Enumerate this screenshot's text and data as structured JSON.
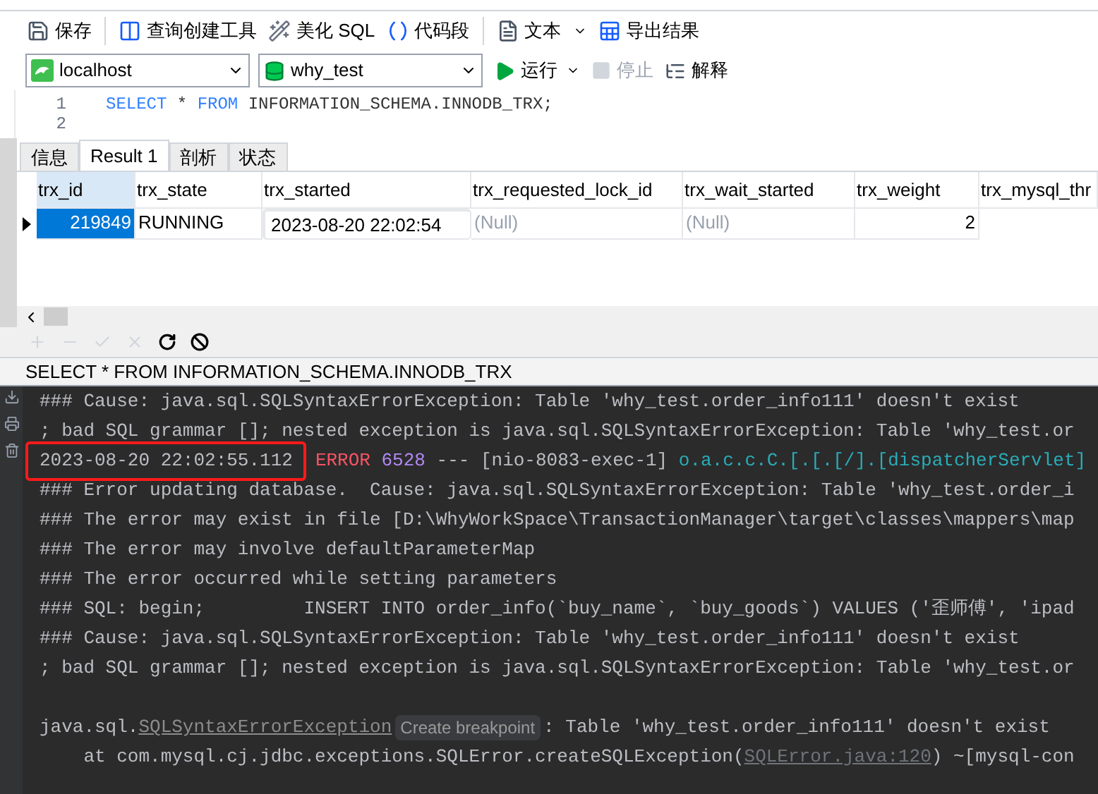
{
  "toolbar": [
    {
      "label": "保存",
      "kind": "save"
    },
    {
      "label": "查询创建工具",
      "kind": "builder"
    },
    {
      "label": "美化 SQL",
      "kind": "beautify"
    },
    {
      "label": "代码段",
      "kind": "snippet"
    },
    {
      "label": "文本",
      "kind": "text",
      "dropdown": true
    },
    {
      "label": "导出结果",
      "kind": "export"
    }
  ],
  "connection": {
    "server": "localhost",
    "database": "why_test"
  },
  "actions": [
    {
      "label": "运行",
      "kind": "run",
      "dropdown": true,
      "disabled": false
    },
    {
      "label": "停止",
      "kind": "stop",
      "disabled": true
    },
    {
      "label": "解释",
      "kind": "explain",
      "disabled": false
    }
  ],
  "editor": {
    "lines": [
      {
        "number": "1",
        "tokens": [
          {
            "text": "SELECT",
            "kind": "keyword"
          },
          {
            "text": " * ",
            "kind": "plain"
          },
          {
            "text": "FROM",
            "kind": "keyword"
          },
          {
            "text": " INFORMATION_SCHEMA.INNODB_TRX;",
            "kind": "plain"
          }
        ]
      },
      {
        "number": "2"
      }
    ]
  },
  "tabs": [
    {
      "label": "信息",
      "selected": false
    },
    {
      "label": "Result 1",
      "selected": true
    },
    {
      "label": "剖析",
      "selected": false
    },
    {
      "label": "状态",
      "selected": false
    }
  ],
  "table": {
    "columns": [
      "trx_id",
      "trx_state",
      "trx_started",
      "trx_requested_lock_id",
      "trx_wait_started",
      "trx_weight",
      "trx_mysql_thr"
    ],
    "rows": [
      {
        "selected": true,
        "cells": [
          {
            "text": "219849",
            "kind": "number",
            "highlighted": false
          },
          {
            "text": "RUNNING",
            "kind": "text",
            "highlighted": false
          },
          {
            "text": "2023-08-20 22:02:54",
            "kind": "text",
            "highlighted": true
          },
          {
            "text": "(Null)",
            "kind": "null",
            "highlighted": false
          },
          {
            "text": "(Null)",
            "kind": "null",
            "highlighted": false
          },
          {
            "text": "2",
            "kind": "number",
            "highlighted": false
          }
        ]
      }
    ]
  },
  "grid_toolbar": [
    {
      "kind": "add",
      "disabled": true
    },
    {
      "kind": "delete",
      "disabled": true
    },
    {
      "kind": "apply",
      "disabled": true
    },
    {
      "kind": "discard",
      "disabled": true
    },
    {
      "kind": "refresh",
      "disabled": false
    },
    {
      "kind": "stop",
      "disabled": false
    }
  ],
  "status_bar": "SELECT * FROM INFORMATION_SCHEMA.INNODB_TRX",
  "console": {
    "lines": [
      {
        "segments": [
          {
            "text": "### Cause: java.sql.SQLSyntaxErrorException: Table 'why_test.order_info111' doesn't exist",
            "kind": "plain"
          }
        ]
      },
      {
        "segments": [
          {
            "text": "; bad SQL grammar []; nested exception is java.sql.SQLSyntaxErrorException: Table 'why_test.or",
            "kind": "plain"
          }
        ]
      },
      {
        "segments": [
          {
            "text": "2023-08-20 22:02:55.112",
            "kind": "plain",
            "highlighted": true
          },
          {
            "text": "ERROR",
            "kind": "error"
          },
          {
            "text": " 6528",
            "kind": "pid"
          },
          {
            "text": " --- [nio-8083-exec-1]",
            "kind": "plain"
          },
          {
            "text": " o.a.c.c.C.[.[.[/].[dispatcherServlet]",
            "kind": "logger"
          }
        ]
      },
      {
        "segments": [
          {
            "text": "### Error updating database.  Cause: java.sql.SQLSyntaxErrorException: Table 'why_test.order_i",
            "kind": "plain"
          }
        ]
      },
      {
        "segments": [
          {
            "text": "### The error may exist in file [D:\\WhyWorkSpace\\TransactionManager\\target\\classes\\mappers\\map",
            "kind": "plain"
          }
        ]
      },
      {
        "segments": [
          {
            "text": "### The error may involve defaultParameterMap",
            "kind": "plain"
          }
        ]
      },
      {
        "segments": [
          {
            "text": "### The error occurred while setting parameters",
            "kind": "plain"
          }
        ]
      },
      {
        "segments": [
          {
            "text": "### SQL: begin;         INSERT INTO order_info(`buy_name`, `buy_goods`) VALUES ('歪师傅', 'ipad",
            "kind": "plain"
          }
        ]
      },
      {
        "segments": [
          {
            "text": "### Cause: java.sql.SQLSyntaxErrorException: Table 'why_test.order_info111' doesn't exist",
            "kind": "plain"
          }
        ]
      },
      {
        "segments": [
          {
            "text": "; bad SQL grammar []; nested exception is java.sql.SQLSyntaxErrorException: Table 'why_test.or",
            "kind": "plain"
          }
        ]
      },
      {
        "kind": "blank"
      },
      {
        "segments": [
          {
            "text": "java.sql.",
            "kind": "plain"
          },
          {
            "text": "SQLSyntaxErrorException",
            "kind": "link"
          },
          {
            "text": "Create breakpoint",
            "kind": "hint"
          },
          {
            "text": ": Table 'why_test.order_info111' doesn't exist",
            "kind": "plain"
          }
        ]
      },
      {
        "segments": [
          {
            "text": "    at com.mysql.cj.jdbc.exceptions.SQLError.createSQLException(",
            "kind": "plain"
          },
          {
            "text": "SQLError.java:120",
            "kind": "source"
          },
          {
            "text": ") ~[mysql-con",
            "kind": "plain"
          }
        ]
      }
    ]
  }
}
